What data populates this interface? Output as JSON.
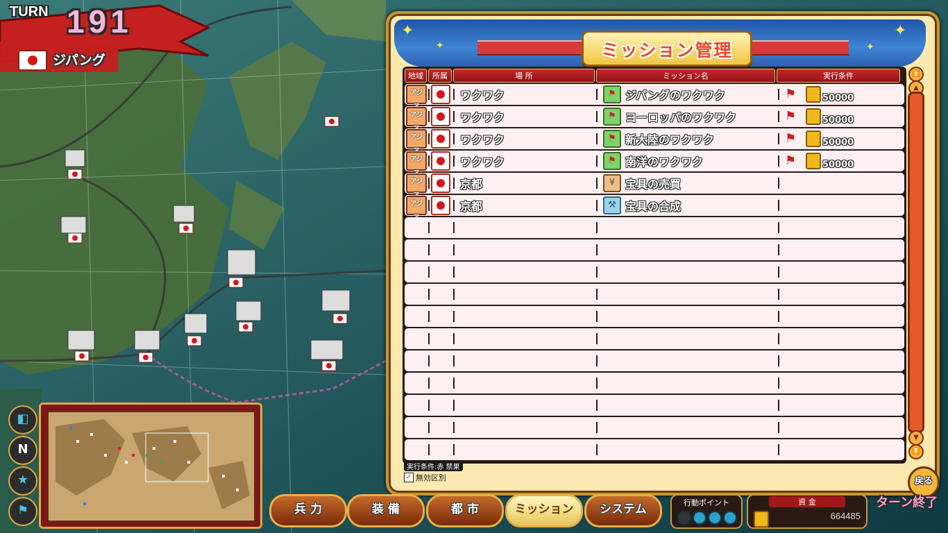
{
  "turn": {
    "label": "TURN",
    "number": "191"
  },
  "nation": {
    "name": "ジパング"
  },
  "panel": {
    "title": "ミッション管理",
    "headers": [
      "地域",
      "所属",
      "場 所",
      "ミッション名",
      "実行条件"
    ],
    "rows": [
      {
        "region": "アジア",
        "place": "ワクワク",
        "mission": "ジパングのワクワク",
        "mission_icon": "flag",
        "money": "50000"
      },
      {
        "region": "アジア",
        "place": "ワクワク",
        "mission": "ヨーロッパのワクワク",
        "mission_icon": "flag",
        "money": "50000"
      },
      {
        "region": "アジア",
        "place": "ワクワク",
        "mission": "新大陸のワクワク",
        "mission_icon": "flag",
        "money": "50000"
      },
      {
        "region": "アジア",
        "place": "ワクワク",
        "mission": "南洋のワクワク",
        "mission_icon": "flag",
        "money": "50000"
      },
      {
        "region": "アジア",
        "place": "京都",
        "mission": "宝具の売買",
        "mission_icon": "sell",
        "money": ""
      },
      {
        "region": "アジア",
        "place": "京都",
        "mission": "宝具の合成",
        "mission_icon": "merge",
        "money": ""
      }
    ],
    "empty_rows": 11,
    "legend_text": "実行条件:赤 禁果",
    "legend_check": "無効区別",
    "back_label": "戻る"
  },
  "menu": {
    "buttons": [
      "兵 力",
      "装 備",
      "都 市",
      "ミッション",
      "システム"
    ],
    "active": "ミッション"
  },
  "status": {
    "action_label": "行動ポイント",
    "funds_label": "資 金",
    "funds_value": "664485",
    "end_turn_label": "ターン終了"
  },
  "colors": {
    "panel_bg": "#fbe9b0",
    "header_blue": "#2b5fae",
    "title_red": "#e84a2a",
    "row_bg": "#fdf0f2",
    "map_sea": "#1f4f4a"
  }
}
